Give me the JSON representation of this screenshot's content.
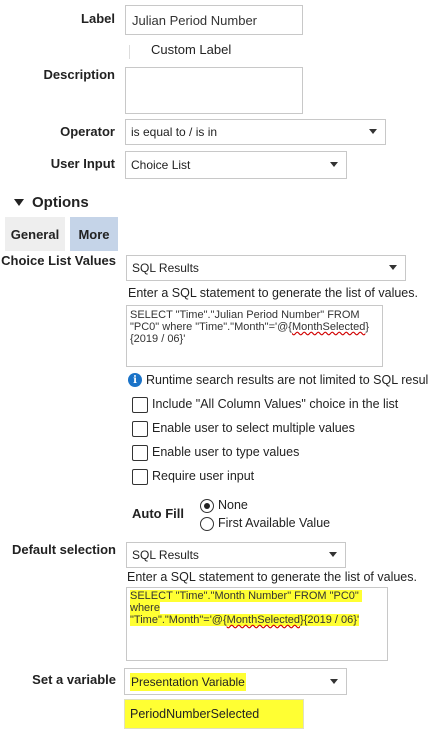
{
  "label": {
    "title": "Label",
    "value": "Julian Period Number",
    "custom_label": "Custom Label"
  },
  "description": {
    "title": "Description",
    "value": ""
  },
  "operator": {
    "title": "Operator",
    "value": "is equal to / is in"
  },
  "user_input": {
    "title": "User Input",
    "value": "Choice List"
  },
  "options": {
    "title": "Options",
    "tabs": [
      "General",
      "More"
    ],
    "active_tab": "More"
  },
  "choice_list_values": {
    "title": "Choice List Values",
    "value": "SQL Results",
    "hint": "Enter a SQL statement to generate the list of values.",
    "sql_part1": "SELECT \"Time\".\"Julian Period Number\" FROM \"PC0\" where \"Time\".\"Month\"='@{",
    "sql_var": "MonthSelected",
    "sql_part2": "}{2019 / 06}'",
    "info": "Runtime search results are not limited to SQL resul"
  },
  "checkboxes": [
    "Include \"All Column Values\" choice in the list",
    "Enable user to select multiple values",
    "Enable user to type values",
    "Require user input"
  ],
  "auto_fill": {
    "title": "Auto Fill",
    "options": [
      "None",
      "First Available Value"
    ],
    "selected": "None"
  },
  "default_selection": {
    "title": "Default selection",
    "value": "SQL Results",
    "hint": "Enter a SQL statement to generate the list of values.",
    "sql_line1": "SELECT \"Time\".\"Month Number\" FROM \"PC0\" where",
    "sql_line2a": "\"Time\".\"Month\"='@{",
    "sql_var": "MonthSelected",
    "sql_line2b": "}{2019 / 06}'"
  },
  "set_variable": {
    "title": "Set a variable",
    "value": "Presentation Variable",
    "variable_name": "PeriodNumberSelected"
  },
  "colors": {
    "highlight": "#ffff33",
    "tab_active": "#c5d4e8",
    "tab_inactive": "#eeeeee",
    "info_blue": "#1a73c8"
  }
}
